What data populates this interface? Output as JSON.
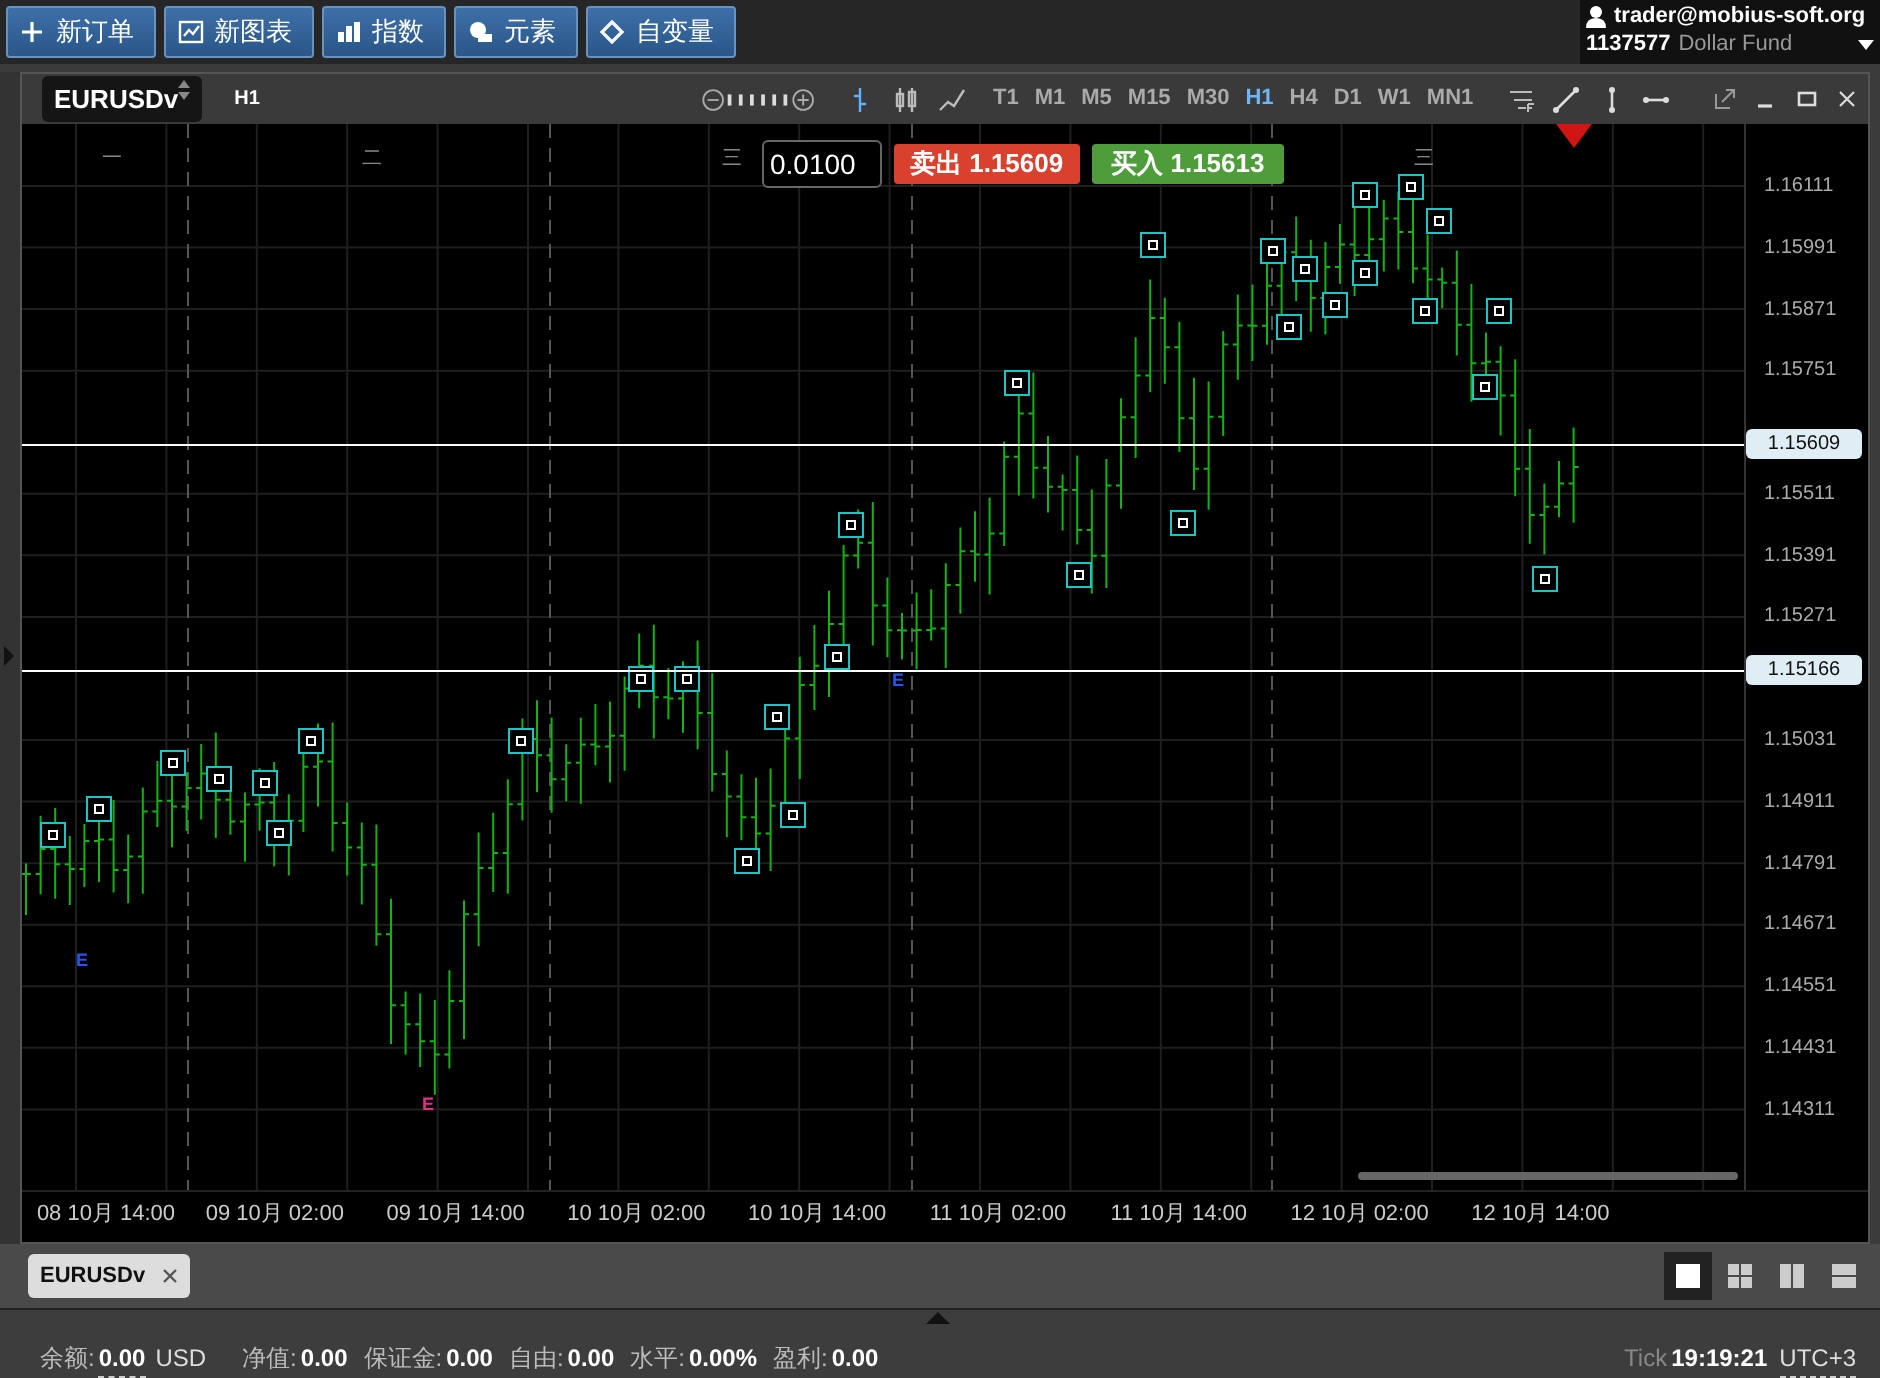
{
  "toolbar": {
    "buttons": [
      {
        "label": "新订单",
        "kind": "plus"
      },
      {
        "label": "新图表",
        "kind": "chart"
      },
      {
        "label": "指数",
        "kind": "bars"
      },
      {
        "label": "元素",
        "kind": "shapes"
      },
      {
        "label": "自变量",
        "kind": "diamond"
      }
    ]
  },
  "account": {
    "email": "trader@mobius-soft.org",
    "number": "1137577",
    "name": "Dollar Fund"
  },
  "chart_window": {
    "symbol": "EURUSDv",
    "period": "H1",
    "chart_types": [
      {
        "kind": "bar",
        "selected": true
      },
      {
        "kind": "candle",
        "selected": false
      },
      {
        "kind": "line",
        "selected": false
      }
    ],
    "timeframes": [
      {
        "label": "T1",
        "selected": false
      },
      {
        "label": "M1",
        "selected": false
      },
      {
        "label": "M5",
        "selected": false
      },
      {
        "label": "M15",
        "selected": false
      },
      {
        "label": "M30",
        "selected": false
      },
      {
        "label": "H1",
        "selected": true
      },
      {
        "label": "H4",
        "selected": false
      },
      {
        "label": "D1",
        "selected": false
      },
      {
        "label": "W1",
        "selected": false
      },
      {
        "label": "MN1",
        "selected": false
      }
    ]
  },
  "order_panel": {
    "lot": "0.0100",
    "sell": {
      "label": "卖出",
      "price": "1.15609"
    },
    "buy": {
      "label": "买入",
      "price": "1.15613"
    }
  },
  "chart": {
    "day_labels": [
      "一",
      "二",
      "三",
      "三"
    ],
    "price_ticks": [
      "1.16111",
      "1.15991",
      "1.15871",
      "1.15751",
      "1.15511",
      "1.15391",
      "1.15271",
      "1.15031",
      "1.14911",
      "1.14791",
      "1.14671",
      "1.14551",
      "1.14431",
      "1.14311"
    ],
    "price_lines": [
      {
        "price": "1.15609"
      },
      {
        "price": "1.15166"
      }
    ],
    "time_labels": [
      "08 10月 14:00",
      "09 10月 02:00",
      "09 10月 14:00",
      "10 10月 02:00",
      "10 10月 14:00",
      "11 10月 02:00",
      "11 10月 14:00",
      "12 10月 02:00",
      "12 10月 14:00"
    ],
    "markers": [
      {
        "label": "E",
        "color": "#2a55ee"
      },
      {
        "label": "E",
        "color": "#2a55ee"
      },
      {
        "label": "E",
        "color": "#e0308a"
      }
    ]
  },
  "tabs": [
    {
      "label": "EURUSDv",
      "selected": true
    }
  ],
  "layouts": [
    {
      "kind": "single",
      "selected": true
    },
    {
      "kind": "grid",
      "selected": false
    },
    {
      "kind": "columns",
      "selected": false
    },
    {
      "kind": "rows",
      "selected": false
    }
  ],
  "status": {
    "items": [
      {
        "label": "余额:",
        "value": "0.00",
        "unit": "USD"
      },
      {
        "label": "净值:",
        "value": "0.00"
      },
      {
        "label": "保证金:",
        "value": "0.00"
      },
      {
        "label": "自由:",
        "value": "0.00"
      },
      {
        "label": "水平:",
        "value": "0.00%"
      },
      {
        "label": "盈利:",
        "value": "0.00"
      }
    ],
    "tick": {
      "label": "Tick",
      "time": "19:19:21",
      "zone": "UTC+3"
    }
  }
}
